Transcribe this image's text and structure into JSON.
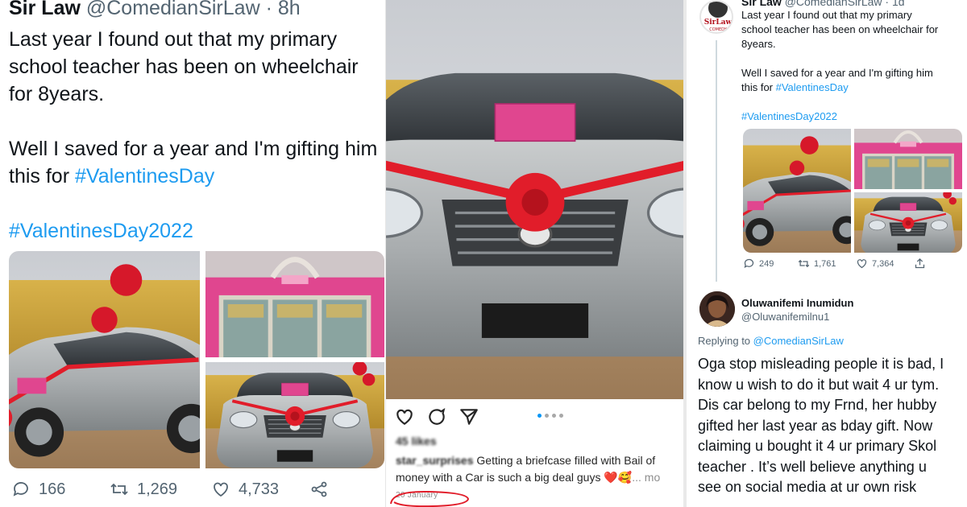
{
  "panel1": {
    "author_name": "Sir Law",
    "author_handle": "@ComedianSirLaw",
    "separator": "·",
    "time": "8h",
    "tweet_lines": [
      "Last year I found out that my primary",
      "school teacher has been on wheelchair",
      "for 8years.",
      "",
      "Well I saved for a year and I'm gifting him",
      "this for "
    ],
    "hashtag_inline": "#ValentinesDay",
    "hashtag_line": "#ValentinesDay2022",
    "replies": "166",
    "retweets": "1,269",
    "likes": "4,733",
    "icons": {
      "reply": "reply-icon",
      "retweet": "retweet-icon",
      "like": "heart-icon",
      "share": "share-icon"
    }
  },
  "panel2": {
    "likes_text": "45 likes",
    "username": "star_surprises",
    "caption": "Getting a briefcase filled with Bail of money with a Car is such a big deal guys ❤️🥰",
    "more": "... mo",
    "date": "20 January",
    "icons": {
      "like": "heart-icon",
      "comment": "comment-icon",
      "share": "send-icon"
    }
  },
  "panel3": {
    "author_name": "Sir Law",
    "author_handle": "@ComedianSirLaw · 1d",
    "avatar_text_1": "SirLaw",
    "avatar_text_2": "COMEDY",
    "tweet_lines": [
      "Last year I found out that my primary",
      "school teacher has been on wheelchair for",
      "8years.",
      "",
      "Well I saved for a year and I'm gifting him",
      "this for "
    ],
    "hashtag_inline": "#ValentinesDay",
    "hashtag_line": "#ValentinesDay2022",
    "replies": "249",
    "retweets": "1,761",
    "likes": "7,364",
    "reply_author_name": "Oluwanifemi Inumidun",
    "reply_author_handle": "@Oluwanifemilnu1",
    "replying_label": "Replying to ",
    "replying_handle": "@ComedianSirLaw",
    "reply_lines": [
      "Oga stop misleading people it is bad, I",
      "know u wish to do it but wait 4 ur tym.",
      "Dis car belong to my Frnd, her hubby",
      "gifted her last year as bday gift. Now",
      "claiming u bought it 4 ur primary Skol",
      "teacher . It’s well  believe anything u",
      "see on social media at ur own risk"
    ]
  },
  "colors": {
    "link": "#1d9bf0",
    "muted": "#536471",
    "ribbon": "#e11d2a",
    "box_pink": "#e0468f",
    "car_silver": "#a9adaf"
  }
}
